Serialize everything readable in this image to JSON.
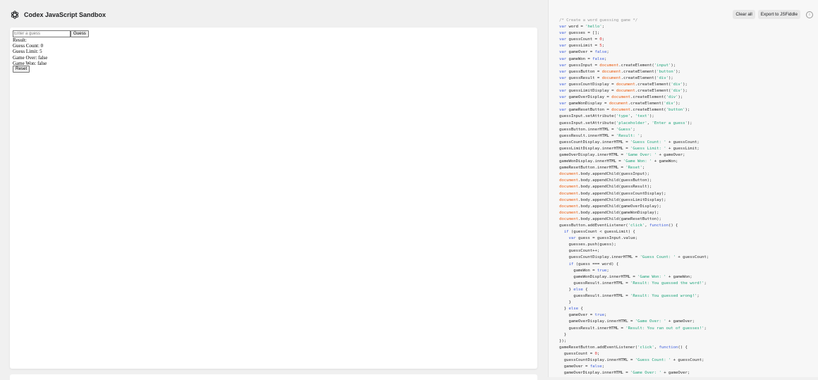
{
  "header": {
    "title": "Codex JavaScript Sandbox"
  },
  "toolbar": {
    "clear_label": "Clear all",
    "export_label": "Export to JSFiddle",
    "info_glyph": "i"
  },
  "sandbox": {
    "input_placeholder": "Enter a guess",
    "guess_label": "Guess",
    "result": "Result:",
    "guess_count": "Guess Count: 0",
    "guess_limit": "Guess Limit: 5",
    "game_over": "Game Over: false",
    "game_won": "Game Won: false",
    "reset_label": "Reset"
  },
  "code_lines": [
    "/* Create a word guessing game */",
    "var word = 'hello';",
    "var guesses = [];",
    "var guessCount = 0;",
    "var guessLimit = 5;",
    "var gameOver = false;",
    "var gameWon = false;",
    "var guessInput = document.createElement('input');",
    "var guessButton = document.createElement('button');",
    "var guessResult = document.createElement('div');",
    "var guessCountDisplay = document.createElement('div');",
    "var guessLimitDisplay = document.createElement('div');",
    "var gameOverDisplay = document.createElement('div');",
    "var gameWonDisplay = document.createElement('div');",
    "var gameResetButton = document.createElement('button');",
    "guessInput.setAttribute('type', 'text');",
    "guessInput.setAttribute('placeholder', 'Enter a guess');",
    "guessButton.innerHTML = 'Guess';",
    "guessResult.innerHTML = 'Result: ';",
    "guessCountDisplay.innerHTML = 'Guess Count: ' + guessCount;",
    "guessLimitDisplay.innerHTML = 'Guess Limit: ' + guessLimit;",
    "gameOverDisplay.innerHTML = 'Game Over: ' + gameOver;",
    "gameWonDisplay.innerHTML = 'Game Won: ' + gameWon;",
    "gameResetButton.innerHTML = 'Reset';",
    "document.body.appendChild(guessInput);",
    "document.body.appendChild(guessButton);",
    "document.body.appendChild(guessResult);",
    "document.body.appendChild(guessCountDisplay);",
    "document.body.appendChild(guessLimitDisplay);",
    "document.body.appendChild(gameOverDisplay);",
    "document.body.appendChild(gameWonDisplay);",
    "document.body.appendChild(gameResetButton);",
    "guessButton.addEventListener('click', function() {",
    "  if (guessCount < guessLimit) {",
    "    var guess = guessInput.value;",
    "    guesses.push(guess);",
    "    guessCount++;",
    "    guessCountDisplay.innerHTML = 'Guess Count: ' + guessCount;",
    "    if (guess === word) {",
    "      gameWon = true;",
    "      gameWonDisplay.innerHTML = 'Game Won: ' + gameWon;",
    "      guessResult.innerHTML = 'Result: You guessed the word!';",
    "    } else {",
    "      guessResult.innerHTML = 'Result: You guessed wrong!';",
    "    }",
    "  } else {",
    "    gameOver = true;",
    "    gameOverDisplay.innerHTML = 'Game Over: ' + gameOver;",
    "    guessResult.innerHTML = 'Result: You ran out of guesses!';",
    "  }",
    "});",
    "gameResetButton.addEventListener('click', function() {",
    "  guessCount = 0;",
    "  guessCountDisplay.innerHTML = 'Guess Count: ' + guessCount;",
    "  gameOver = false;",
    "  gameOverDisplay.innerHTML = 'Game Over: ' + gameOver;"
  ]
}
